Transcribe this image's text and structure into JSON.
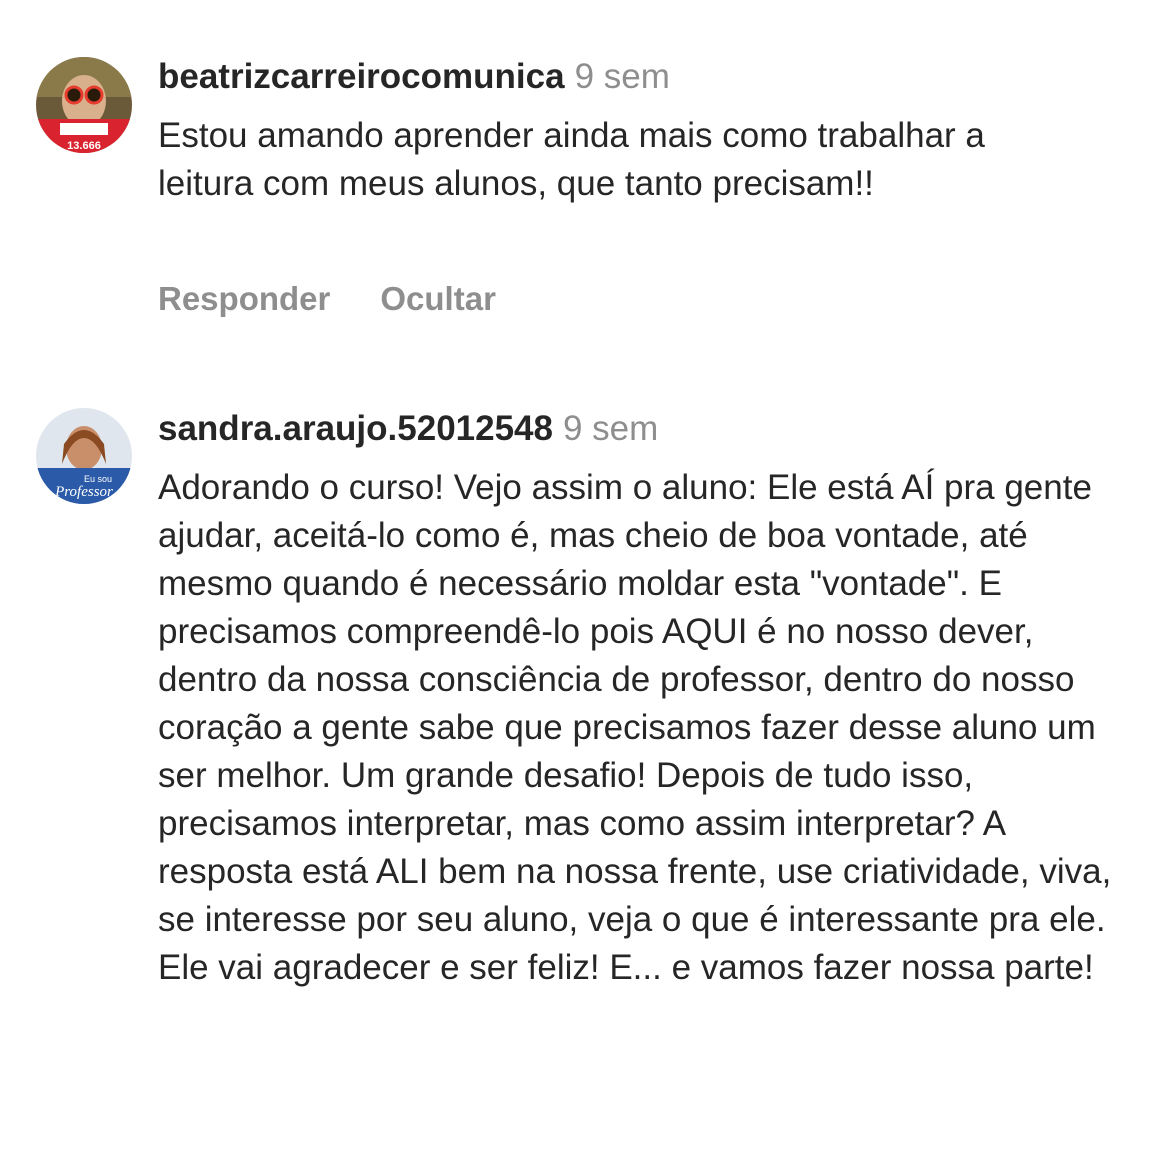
{
  "comments": [
    {
      "username": "beatrizcarreirocomunica",
      "time": "9 sem",
      "text": "Estou amando aprender ainda mais como trabalhar a leitura com meus alunos, que tanto precisam!!",
      "avatar_text": "13.666",
      "actions": [
        "Responder",
        "Ocultar"
      ]
    },
    {
      "username": "sandra.araujo.52012548",
      "time": "9 sem",
      "text": "Adorando o curso! Vejo assim o aluno: Ele está AÍ pra gente ajudar, aceitá-lo como é, mas cheio de boa vontade, até mesmo  quando é necessário moldar  esta \"vontade\". E precisamos compreendê-lo pois AQUI é no nosso dever, dentro da nossa consciência de professor, dentro do nosso coração a gente sabe que precisamos fazer desse aluno um ser melhor. Um grande desafio! Depois de tudo isso, precisamos interpretar, mas como assim interpretar? A resposta está ALI bem na nossa frente, use criatividade, viva, se interesse por seu aluno, veja o que é interessante pra ele. Ele vai agradecer e ser feliz! E... e vamos fazer nossa parte!",
      "avatar_text_1": "Eu sou",
      "avatar_text_2": "Professor"
    }
  ],
  "colors": {
    "text": "#262626",
    "muted": "#8e8e8e",
    "avatar1_band": "#d9232e",
    "avatar2_band": "#2b5aa8"
  }
}
